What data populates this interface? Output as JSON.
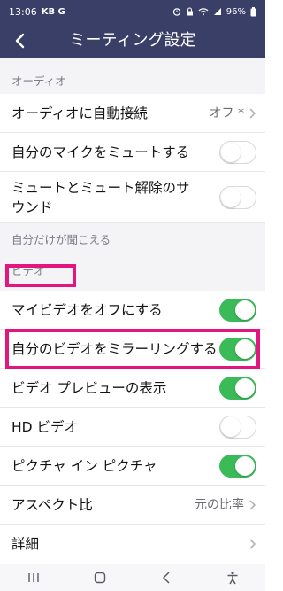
{
  "status_bar": {
    "time": "13:06",
    "left_icons": "KB G",
    "battery": "96%"
  },
  "header": {
    "title": "ミーティング設定"
  },
  "audio": {
    "section_title": "オーディオ",
    "auto_connect": {
      "label": "オーディオに自動接続",
      "value": "オフ *"
    },
    "mute_mic": {
      "label": "自分のマイクをミュートする",
      "state": "off"
    },
    "mute_sound": {
      "label_line1": "ミュートとミュート解除のサ",
      "label_line2": "ウンド",
      "state": "off"
    }
  },
  "hint": {
    "text": "自分だけが聞こえる"
  },
  "video": {
    "section_title": "ビデオ",
    "turn_off_video": {
      "label": "マイビデオをオフにする",
      "state": "on"
    },
    "mirror_video": {
      "label": "自分のビデオをミラーリングする",
      "state": "on"
    },
    "preview": {
      "label": "ビデオ プレビューの表示",
      "state": "on"
    },
    "hd_video": {
      "label": "HD ビデオ",
      "state": "off"
    },
    "pip": {
      "label": "ピクチャ イン ピクチャ",
      "state": "on"
    },
    "aspect": {
      "label": "アスペクト比",
      "value": "元の比率"
    },
    "details": {
      "label": "詳細"
    }
  },
  "colors": {
    "header_bg": "#3a3f67",
    "toggle_on": "#3bbb58",
    "highlight": "#e3157e"
  }
}
